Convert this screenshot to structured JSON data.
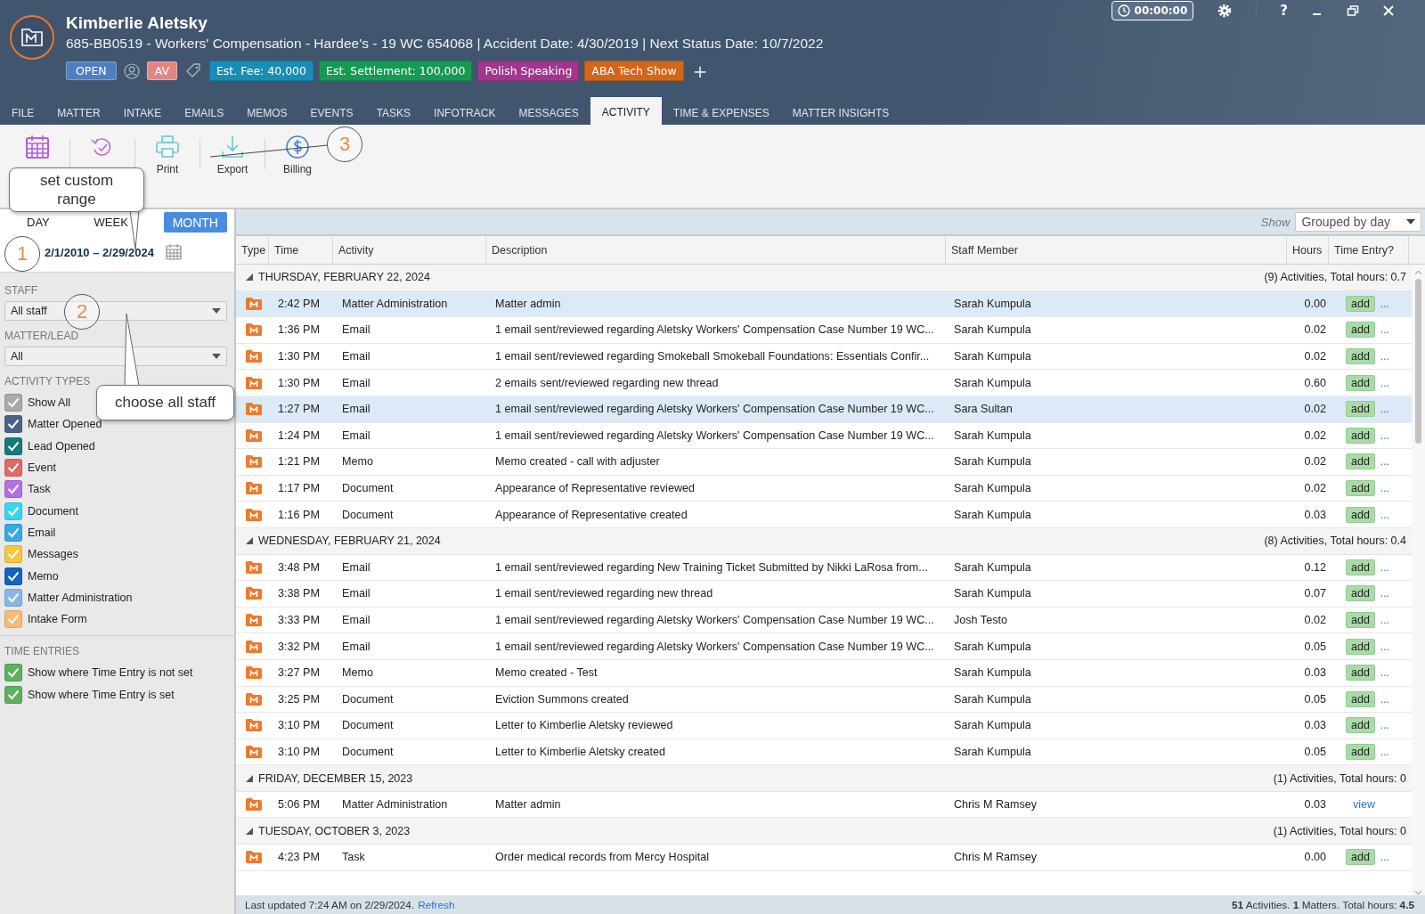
{
  "header": {
    "client_name": "Kimberlie Aletsky",
    "matter_line": "685-BB0519 - Workers' Compensation - Hardee's - 19 WC 654068 | Accident Date: 4/30/2019 | Next Status Date: 10/7/2022",
    "status": "OPEN",
    "initials": "AV",
    "add_tag": "+",
    "timer": "00:00:00",
    "help": "?",
    "tags": [
      {
        "text": "Est. Fee: 40,000",
        "color": "#1a8db5"
      },
      {
        "text": "Est. Settlement: 100,000",
        "color": "#169a52"
      },
      {
        "text": "Polish Speaking",
        "color": "#a2368f"
      },
      {
        "text": "ABA Tech Show",
        "color": "#d4661a"
      }
    ]
  },
  "tabs": [
    {
      "label": "FILE",
      "selected": false
    },
    {
      "label": "MATTER",
      "selected": false
    },
    {
      "label": "INTAKE",
      "selected": false
    },
    {
      "label": "EMAILS",
      "selected": false
    },
    {
      "label": "MEMOS",
      "selected": false
    },
    {
      "label": "EVENTS",
      "selected": false
    },
    {
      "label": "TASKS",
      "selected": false
    },
    {
      "label": "INFOTRACK",
      "selected": false
    },
    {
      "label": "MESSAGES",
      "selected": false
    },
    {
      "label": "ACTIVITY",
      "selected": true
    },
    {
      "label": "TIME & EXPENSES",
      "selected": false
    },
    {
      "label": "MATTER INSIGHTS",
      "selected": false
    }
  ],
  "toolbar": [
    {
      "kind": "calendar"
    },
    {
      "kind": "undo"
    },
    {
      "kind": "print",
      "label": "Print"
    },
    {
      "kind": "export",
      "label": "Export"
    },
    {
      "kind": "billing",
      "label": "Billing"
    }
  ],
  "sidebar": {
    "periods": [
      {
        "label": "DAY",
        "selected": false
      },
      {
        "label": "WEEK",
        "selected": false
      },
      {
        "label": "MONTH",
        "selected": true
      }
    ],
    "date_range": "2/1/2010 – 2/29/2024",
    "staff_label": "STAFF",
    "staff_value": "All staff",
    "matter_label": "MATTER/LEAD",
    "matter_value": "All",
    "types_label": "ACTIVITY TYPES",
    "activity_types": [
      {
        "label": "Show All",
        "checked": true,
        "color": "#a9a9a9"
      },
      {
        "label": "Matter Opened",
        "checked": true,
        "color": "#4a6384"
      },
      {
        "label": "Lead Opened",
        "checked": true,
        "color": "#177a78"
      },
      {
        "label": "Event",
        "checked": true,
        "color": "#e06a66"
      },
      {
        "label": "Task",
        "checked": true,
        "color": "#b46ee8"
      },
      {
        "label": "Document",
        "checked": true,
        "color": "#35d6f2"
      },
      {
        "label": "Email",
        "checked": true,
        "color": "#3aa7e6"
      },
      {
        "label": "Messages",
        "checked": true,
        "color": "#f6c63d"
      },
      {
        "label": "Memo",
        "checked": true,
        "color": "#1463c2"
      },
      {
        "label": "Matter Administration",
        "checked": true,
        "color": "#88b6e8"
      },
      {
        "label": "Intake Form",
        "checked": true,
        "color": "#f8bb73"
      }
    ],
    "time_label": "TIME ENTRIES",
    "time_entries": [
      {
        "label": "Show where Time Entry is not set",
        "checked": true,
        "color": "#5cb15e"
      },
      {
        "label": "Show where Time Entry is set",
        "checked": true,
        "color": "#5cb15e"
      }
    ]
  },
  "grid": {
    "show_label": "Show",
    "show_value": "Grouped by day",
    "columns": [
      "Type",
      "Time",
      "Activity",
      "Description",
      "Staff Member",
      "Hours",
      "Time Entry?"
    ],
    "groups": [
      {
        "date": "THURSDAY, FEBRUARY 22, 2024",
        "summary": "(9) Activities, Total hours: 0.7",
        "rows": [
          {
            "time": "2:42 PM",
            "activity": "Matter Administration",
            "description": "Matter admin",
            "staff": "Sarah Kumpula",
            "hours": "0.00",
            "entry": {
              "kind": "add",
              "label": "add",
              "more": "..."
            },
            "selected": true
          },
          {
            "time": "1:36 PM",
            "activity": "Email",
            "description": "1 email sent/reviewed regarding Aletsky Workers' Compensation Case Number 19 WC...",
            "staff": "Sarah Kumpula",
            "hours": "0.02",
            "entry": {
              "kind": "add",
              "label": "add",
              "more": "..."
            },
            "selected": false
          },
          {
            "time": "1:30 PM",
            "activity": "Email",
            "description": "1 email sent/reviewed regarding Smokeball Smokeball Foundations: Essentials Confir...",
            "staff": "Sarah Kumpula",
            "hours": "0.02",
            "entry": {
              "kind": "add",
              "label": "add",
              "more": "..."
            },
            "selected": false
          },
          {
            "time": "1:30 PM",
            "activity": "Email",
            "description": "2 emails sent/reviewed regarding new thread",
            "staff": "Sarah Kumpula",
            "hours": "0.60",
            "entry": {
              "kind": "add",
              "label": "add",
              "more": "..."
            },
            "selected": false
          },
          {
            "time": "1:27 PM",
            "activity": "Email",
            "description": "1 email sent/reviewed regarding Aletsky Workers' Compensation Case Number 19 WC...",
            "staff": "Sara Sultan",
            "hours": "0.02",
            "entry": {
              "kind": "add",
              "label": "add",
              "more": "..."
            },
            "selected": true
          },
          {
            "time": "1:24 PM",
            "activity": "Email",
            "description": "1 email sent/reviewed regarding Aletsky Workers' Compensation Case Number 19 WC...",
            "staff": "Sarah Kumpula",
            "hours": "0.02",
            "entry": {
              "kind": "add",
              "label": "add",
              "more": "..."
            },
            "selected": false
          },
          {
            "time": "1:21 PM",
            "activity": "Memo",
            "description": "Memo created - call with adjuster",
            "staff": "Sarah Kumpula",
            "hours": "0.02",
            "entry": {
              "kind": "add",
              "label": "add",
              "more": "..."
            },
            "selected": false
          },
          {
            "time": "1:17 PM",
            "activity": "Document",
            "description": "Appearance of Representative reviewed",
            "staff": "Sarah Kumpula",
            "hours": "0.02",
            "entry": {
              "kind": "add",
              "label": "add",
              "more": "..."
            },
            "selected": false
          },
          {
            "time": "1:16 PM",
            "activity": "Document",
            "description": "Appearance of Representative created",
            "staff": "Sarah Kumpula",
            "hours": "0.03",
            "entry": {
              "kind": "add",
              "label": "add",
              "more": "..."
            },
            "selected": false
          }
        ]
      },
      {
        "date": "WEDNESDAY, FEBRUARY 21, 2024",
        "summary": "(8) Activities, Total hours: 0.4",
        "rows": [
          {
            "time": "3:48 PM",
            "activity": "Email",
            "description": "1 email sent/reviewed regarding New Training Ticket Submitted by Nikki LaRosa from...",
            "staff": "Sarah Kumpula",
            "hours": "0.12",
            "entry": {
              "kind": "add",
              "label": "add",
              "more": "..."
            },
            "selected": false
          },
          {
            "time": "3:38 PM",
            "activity": "Email",
            "description": "1 email sent/reviewed regarding new thread",
            "staff": "Sarah Kumpula",
            "hours": "0.07",
            "entry": {
              "kind": "add",
              "label": "add",
              "more": "..."
            },
            "selected": false
          },
          {
            "time": "3:33 PM",
            "activity": "Email",
            "description": "1 email sent/reviewed regarding Aletsky Workers' Compensation Case Number 19 WC...",
            "staff": "Josh Testo",
            "hours": "0.02",
            "entry": {
              "kind": "add",
              "label": "add",
              "more": "..."
            },
            "selected": false
          },
          {
            "time": "3:32 PM",
            "activity": "Email",
            "description": "1 email sent/reviewed regarding Aletsky Workers' Compensation Case Number 19 WC...",
            "staff": "Sarah Kumpula",
            "hours": "0.05",
            "entry": {
              "kind": "add",
              "label": "add",
              "more": "..."
            },
            "selected": false
          },
          {
            "time": "3:27 PM",
            "activity": "Memo",
            "description": "Memo created - Test",
            "staff": "Sarah Kumpula",
            "hours": "0.03",
            "entry": {
              "kind": "add",
              "label": "add",
              "more": "..."
            },
            "selected": false
          },
          {
            "time": "3:25 PM",
            "activity": "Document",
            "description": "Eviction Summons created",
            "staff": "Sarah Kumpula",
            "hours": "0.05",
            "entry": {
              "kind": "add",
              "label": "add",
              "more": "..."
            },
            "selected": false
          },
          {
            "time": "3:10 PM",
            "activity": "Document",
            "description": "Letter to Kimberlie Aletsky reviewed",
            "staff": "Sarah Kumpula",
            "hours": "0.03",
            "entry": {
              "kind": "add",
              "label": "add",
              "more": "..."
            },
            "selected": false
          },
          {
            "time": "3:10 PM",
            "activity": "Document",
            "description": "Letter to Kimberlie Aletsky created",
            "staff": "Sarah Kumpula",
            "hours": "0.05",
            "entry": {
              "kind": "add",
              "label": "add",
              "more": "..."
            },
            "selected": false
          }
        ]
      },
      {
        "date": "FRIDAY, DECEMBER 15, 2023",
        "summary": "(1) Activities, Total hours: 0",
        "rows": [
          {
            "time": "5:06 PM",
            "activity": "Matter Administration",
            "description": "Matter admin",
            "staff": "Chris M Ramsey",
            "hours": "0.03",
            "entry": {
              "kind": "view",
              "label": "view"
            },
            "selected": false
          }
        ]
      },
      {
        "date": "TUESDAY, OCTOBER 3, 2023",
        "summary": "(1) Activities, Total hours: 0",
        "rows": [
          {
            "time": "4:23 PM",
            "activity": "Task",
            "description": "Order medical records from Mercy Hospital",
            "staff": "Chris M Ramsey",
            "hours": "0.00",
            "entry": {
              "kind": "add",
              "label": "add",
              "more": "..."
            },
            "selected": false
          }
        ]
      }
    ]
  },
  "status_bar": {
    "updated": "Last updated 7:24 AM on 2/29/2024.",
    "refresh": "Refresh",
    "totals": "**51** Activities. **1** Matters. Total hours: **4.5**"
  },
  "annotations": [
    {
      "kind": "callout",
      "text": "set custom range"
    },
    {
      "kind": "step",
      "text": "1"
    },
    {
      "kind": "step",
      "text": "2"
    },
    {
      "kind": "callout",
      "text": "choose all staff"
    },
    {
      "kind": "step",
      "text": "3"
    }
  ]
}
